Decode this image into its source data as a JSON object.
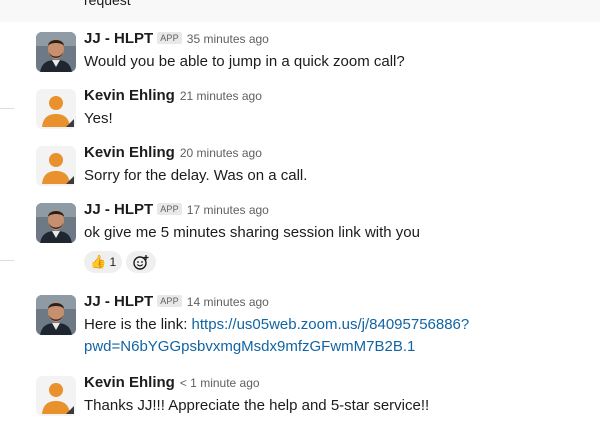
{
  "partial_previous_text": "request",
  "messages": [
    {
      "author": "JJ - HLPT",
      "badge": "APP",
      "time": "35 minutes ago",
      "text": "Would you be able to jump in a quick zoom call?",
      "avatar": "person-photo"
    },
    {
      "author": "Kevin Ehling",
      "badge": "",
      "time": "21 minutes ago",
      "text": "Yes!",
      "avatar": "default-user-avatar"
    },
    {
      "author": "Kevin Ehling",
      "badge": "",
      "time": "20 minutes ago",
      "text": "Sorry for the delay.  Was on a call.",
      "avatar": "default-user-avatar"
    },
    {
      "author": "JJ - HLPT",
      "badge": "APP",
      "time": "17 minutes ago",
      "text": "ok give me 5 minutes sharing session link with you",
      "avatar": "person-photo",
      "reactions": [
        {
          "emoji": "👍",
          "icon": "thumbs-up-icon",
          "count": "1"
        }
      ],
      "add_reaction_icon": "add-emoji-icon"
    },
    {
      "author": "JJ - HLPT",
      "badge": "APP",
      "time": "14 minutes ago",
      "text_prefix": "Here is the link: ",
      "link_line1": "https://us05web.zoom.us/j/84095756886?",
      "link_line2": "pwd=N6bYGGpsbvxmgMsdx9mfzGFwmM7B2B.1",
      "avatar": "person-photo"
    },
    {
      "author": "Kevin Ehling",
      "badge": "",
      "time": "< 1 minute ago",
      "text": "Thanks JJ!!! Appreciate the help and 5-star service!!",
      "avatar": "default-user-avatar"
    }
  ],
  "colors": {
    "link": "#1264a3",
    "default_avatar_bg": "#f3f3f3",
    "default_avatar_figure": "#e8912d",
    "text": "#1d1c1d",
    "muted": "#616061"
  }
}
